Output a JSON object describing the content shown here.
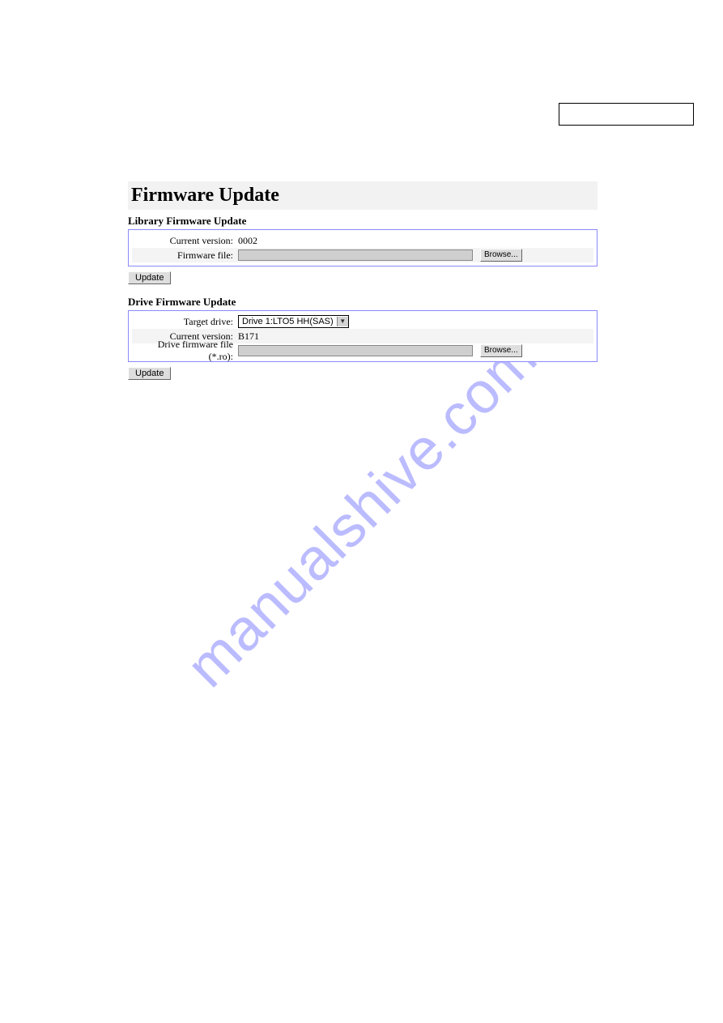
{
  "watermark": "manualshive.com",
  "page": {
    "title": "Firmware Update"
  },
  "library_section": {
    "heading": "Library Firmware Update",
    "current_version_label": "Current version:",
    "current_version_value": "0002",
    "firmware_file_label": "Firmware file:",
    "browse_label": "Browse...",
    "update_label": "Update"
  },
  "drive_section": {
    "heading": "Drive Firmware Update",
    "target_drive_label": "Target drive:",
    "target_drive_value": "Drive 1:LTO5 HH(SAS)",
    "current_version_label": "Current version:",
    "current_version_value": "B171",
    "drive_firmware_file_label": "Drive firmware file (*.ro):",
    "browse_label": "Browse...",
    "update_label": "Update"
  }
}
